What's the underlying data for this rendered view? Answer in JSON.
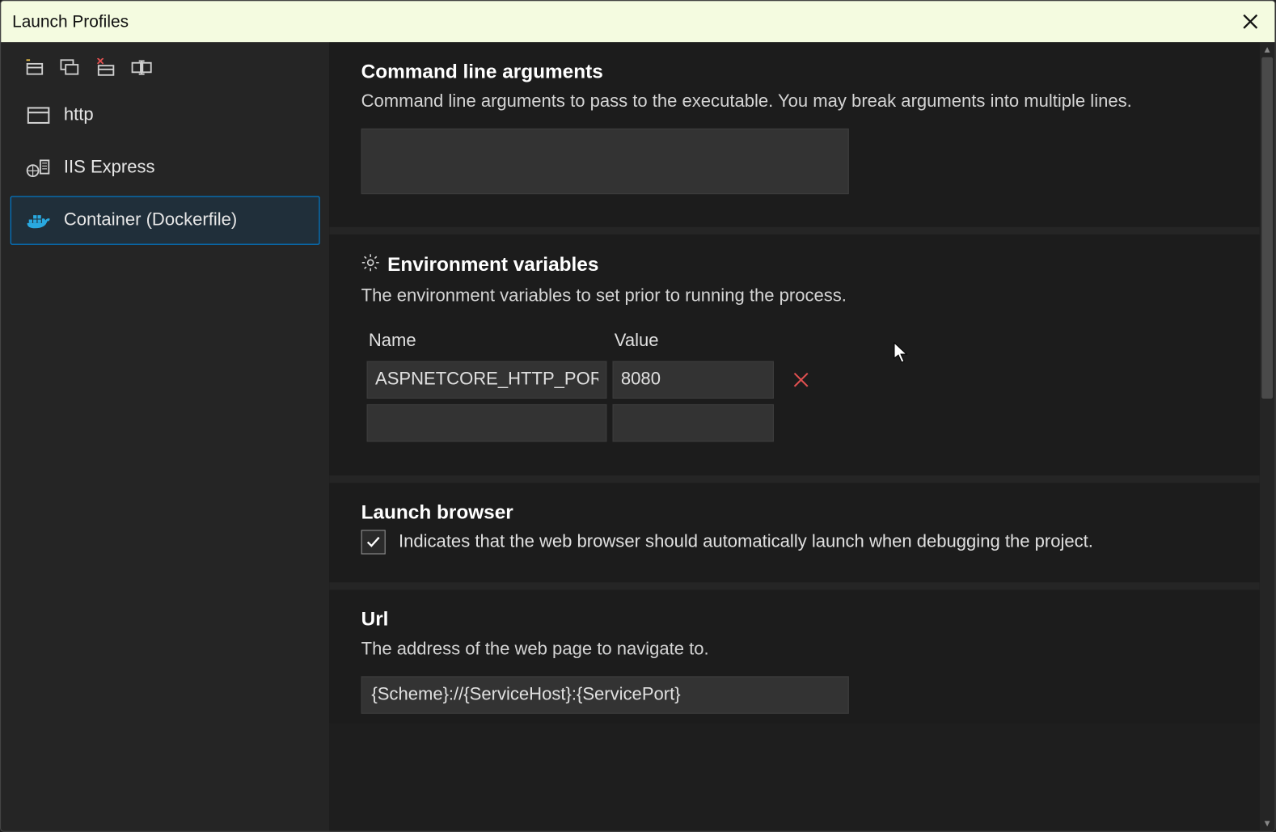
{
  "dialog": {
    "title": "Launch Profiles"
  },
  "profiles": [
    {
      "label": "http"
    },
    {
      "label": "IIS Express"
    },
    {
      "label": "Container (Dockerfile)"
    }
  ],
  "cmdArgs": {
    "heading": "Command line arguments",
    "desc": "Command line arguments to pass to the executable. You may break arguments into multiple lines.",
    "value": ""
  },
  "envVars": {
    "heading": "Environment variables",
    "desc": "The environment variables to set prior to running the process.",
    "nameHeader": "Name",
    "valueHeader": "Value",
    "rows": [
      {
        "name": "ASPNETCORE_HTTP_PORTS",
        "value": "8080"
      },
      {
        "name": "",
        "value": ""
      }
    ]
  },
  "launchBrowser": {
    "heading": "Launch browser",
    "desc": "Indicates that the web browser should automatically launch when debugging the project.",
    "checked": true
  },
  "url": {
    "heading": "Url",
    "desc": "The address of the web page to navigate to.",
    "value": "{Scheme}://{ServiceHost}:{ServicePort}"
  }
}
